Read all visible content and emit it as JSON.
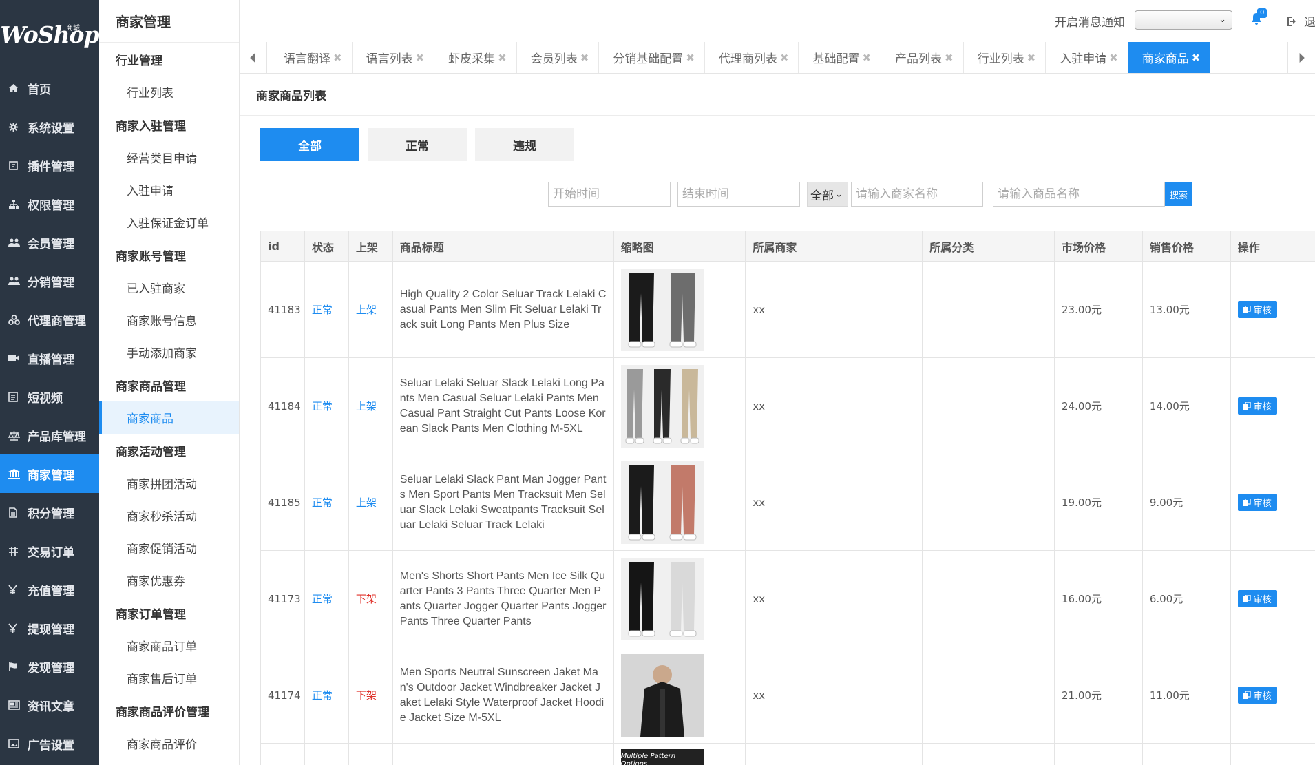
{
  "logo": {
    "text": "WoShop",
    "sub": "商城"
  },
  "menu": [
    {
      "label": "首页",
      "icon": "home-icon"
    },
    {
      "label": "系统设置",
      "icon": "gear-icon"
    },
    {
      "label": "插件管理",
      "icon": "plugin-icon"
    },
    {
      "label": "权限管理",
      "icon": "sitemap-icon"
    },
    {
      "label": "会员管理",
      "icon": "users-icon"
    },
    {
      "label": "分销管理",
      "icon": "users-icon"
    },
    {
      "label": "代理商管理",
      "icon": "share-icon"
    },
    {
      "label": "直播管理",
      "icon": "video-icon"
    },
    {
      "label": "短视频",
      "icon": "film-icon"
    },
    {
      "label": "产品库管理",
      "icon": "scale-icon"
    },
    {
      "label": "商家管理",
      "icon": "bank-icon",
      "active": true
    },
    {
      "label": "积分管理",
      "icon": "document-icon"
    },
    {
      "label": "交易订单",
      "icon": "trade-icon"
    },
    {
      "label": "充值管理",
      "icon": "yen-icon"
    },
    {
      "label": "提现管理",
      "icon": "yen-icon"
    },
    {
      "label": "发现管理",
      "icon": "flag-icon"
    },
    {
      "label": "资讯文章",
      "icon": "news-icon"
    },
    {
      "label": "广告设置",
      "icon": "image-icon"
    }
  ],
  "submenu": {
    "title": "商家管理",
    "entries": [
      {
        "type": "group",
        "label": "行业管理"
      },
      {
        "type": "item",
        "label": "行业列表"
      },
      {
        "type": "group",
        "label": "商家入驻管理"
      },
      {
        "type": "item",
        "label": "经营类目申请"
      },
      {
        "type": "item",
        "label": "入驻申请"
      },
      {
        "type": "item",
        "label": "入驻保证金订单"
      },
      {
        "type": "group",
        "label": "商家账号管理"
      },
      {
        "type": "item",
        "label": "已入驻商家"
      },
      {
        "type": "item",
        "label": "商家账号信息"
      },
      {
        "type": "item",
        "label": "手动添加商家"
      },
      {
        "type": "group",
        "label": "商家商品管理"
      },
      {
        "type": "item",
        "label": "商家商品",
        "active": true
      },
      {
        "type": "group",
        "label": "商家活动管理"
      },
      {
        "type": "item",
        "label": "商家拼团活动"
      },
      {
        "type": "item",
        "label": "商家秒杀活动"
      },
      {
        "type": "item",
        "label": "商家促销活动"
      },
      {
        "type": "item",
        "label": "商家优惠券"
      },
      {
        "type": "group",
        "label": "商家订单管理"
      },
      {
        "type": "item",
        "label": "商家商品订单"
      },
      {
        "type": "item",
        "label": "商家售后订单"
      },
      {
        "type": "group",
        "label": "商家商品评价管理"
      },
      {
        "type": "item",
        "label": "商家商品评价"
      }
    ]
  },
  "topbar": {
    "notify_label": "开启消息通知",
    "badge": "0",
    "logout_label": "退"
  },
  "tabs": [
    {
      "label": "语言翻译"
    },
    {
      "label": "语言列表"
    },
    {
      "label": "虾皮采集"
    },
    {
      "label": "会员列表"
    },
    {
      "label": "分销基础配置"
    },
    {
      "label": "代理商列表"
    },
    {
      "label": "基础配置"
    },
    {
      "label": "产品列表"
    },
    {
      "label": "行业列表"
    },
    {
      "label": "入驻申请"
    },
    {
      "label": "商家商品",
      "active": true
    }
  ],
  "page": {
    "title": "商家商品列表"
  },
  "filters": [
    {
      "label": "全部",
      "active": true
    },
    {
      "label": "正常"
    },
    {
      "label": "违规"
    }
  ],
  "search": {
    "start_placeholder": "开始时间",
    "end_placeholder": "结束时间",
    "select_value": "全部",
    "merchant_placeholder": "请输入商家名称",
    "product_placeholder": "请输入商品名称",
    "button": "搜索"
  },
  "table": {
    "headers": [
      "id",
      "状态",
      "上架",
      "商品标题",
      "缩略图",
      "所属商家",
      "所属分类",
      "市场价格",
      "销售价格",
      "操作"
    ],
    "audit_label": "审核",
    "rows": [
      {
        "id": "41183",
        "status": "正常",
        "shelf": "上架",
        "shelf_color": "#1e8cf0",
        "title": "High Quality 2 Color Seluar Track Lelaki Casual Pants Men Slim Fit Seluar Lelaki Track suit Long Pants Men Plus Size",
        "merchant": "xx",
        "category": "",
        "market_price": "23.00元",
        "sale_price": "13.00元"
      },
      {
        "id": "41184",
        "status": "正常",
        "shelf": "上架",
        "shelf_color": "#1e8cf0",
        "title": "Seluar Lelaki Seluar Slack Lelaki Long Pants Men Casual Seluar Lelaki Pants Men Casual Pant Straight Cut Pants Loose Korean Slack Pants Men Clothing M-5XL",
        "merchant": "xx",
        "category": "",
        "market_price": "24.00元",
        "sale_price": "14.00元"
      },
      {
        "id": "41185",
        "status": "正常",
        "shelf": "上架",
        "shelf_color": "#1e8cf0",
        "title": "Seluar Lelaki Slack Pant Man Jogger Pants Men Sport Pants Men Tracksuit Men Seluar Slack Lelaki Sweatpants Tracksuit Seluar Lelaki Seluar Track Lelaki",
        "merchant": "xx",
        "category": "",
        "market_price": "19.00元",
        "sale_price": "9.00元"
      },
      {
        "id": "41173",
        "status": "正常",
        "shelf": "下架",
        "shelf_color": "#e0312a",
        "title": "Men's Shorts Short Pants Men Ice Silk Quarter Pants 3 Pants Three Quarter Men Pants Quarter Jogger Quarter Pants Jogger Pants Three Quarter Pants",
        "merchant": "xx",
        "category": "",
        "market_price": "16.00元",
        "sale_price": "6.00元"
      },
      {
        "id": "41174",
        "status": "正常",
        "shelf": "下架",
        "shelf_color": "#e0312a",
        "title": "Men Sports Neutral Sunscreen Jaket Man's Outdoor Jacket Windbreaker Jacket Jaket Lelaki Style Waterproof Jacket Hoodie Jacket Size M-5XL",
        "merchant": "xx",
        "category": "",
        "market_price": "21.00元",
        "sale_price": "11.00元"
      }
    ],
    "partial_row_thumb_text": "Multiple Pattern Options"
  }
}
